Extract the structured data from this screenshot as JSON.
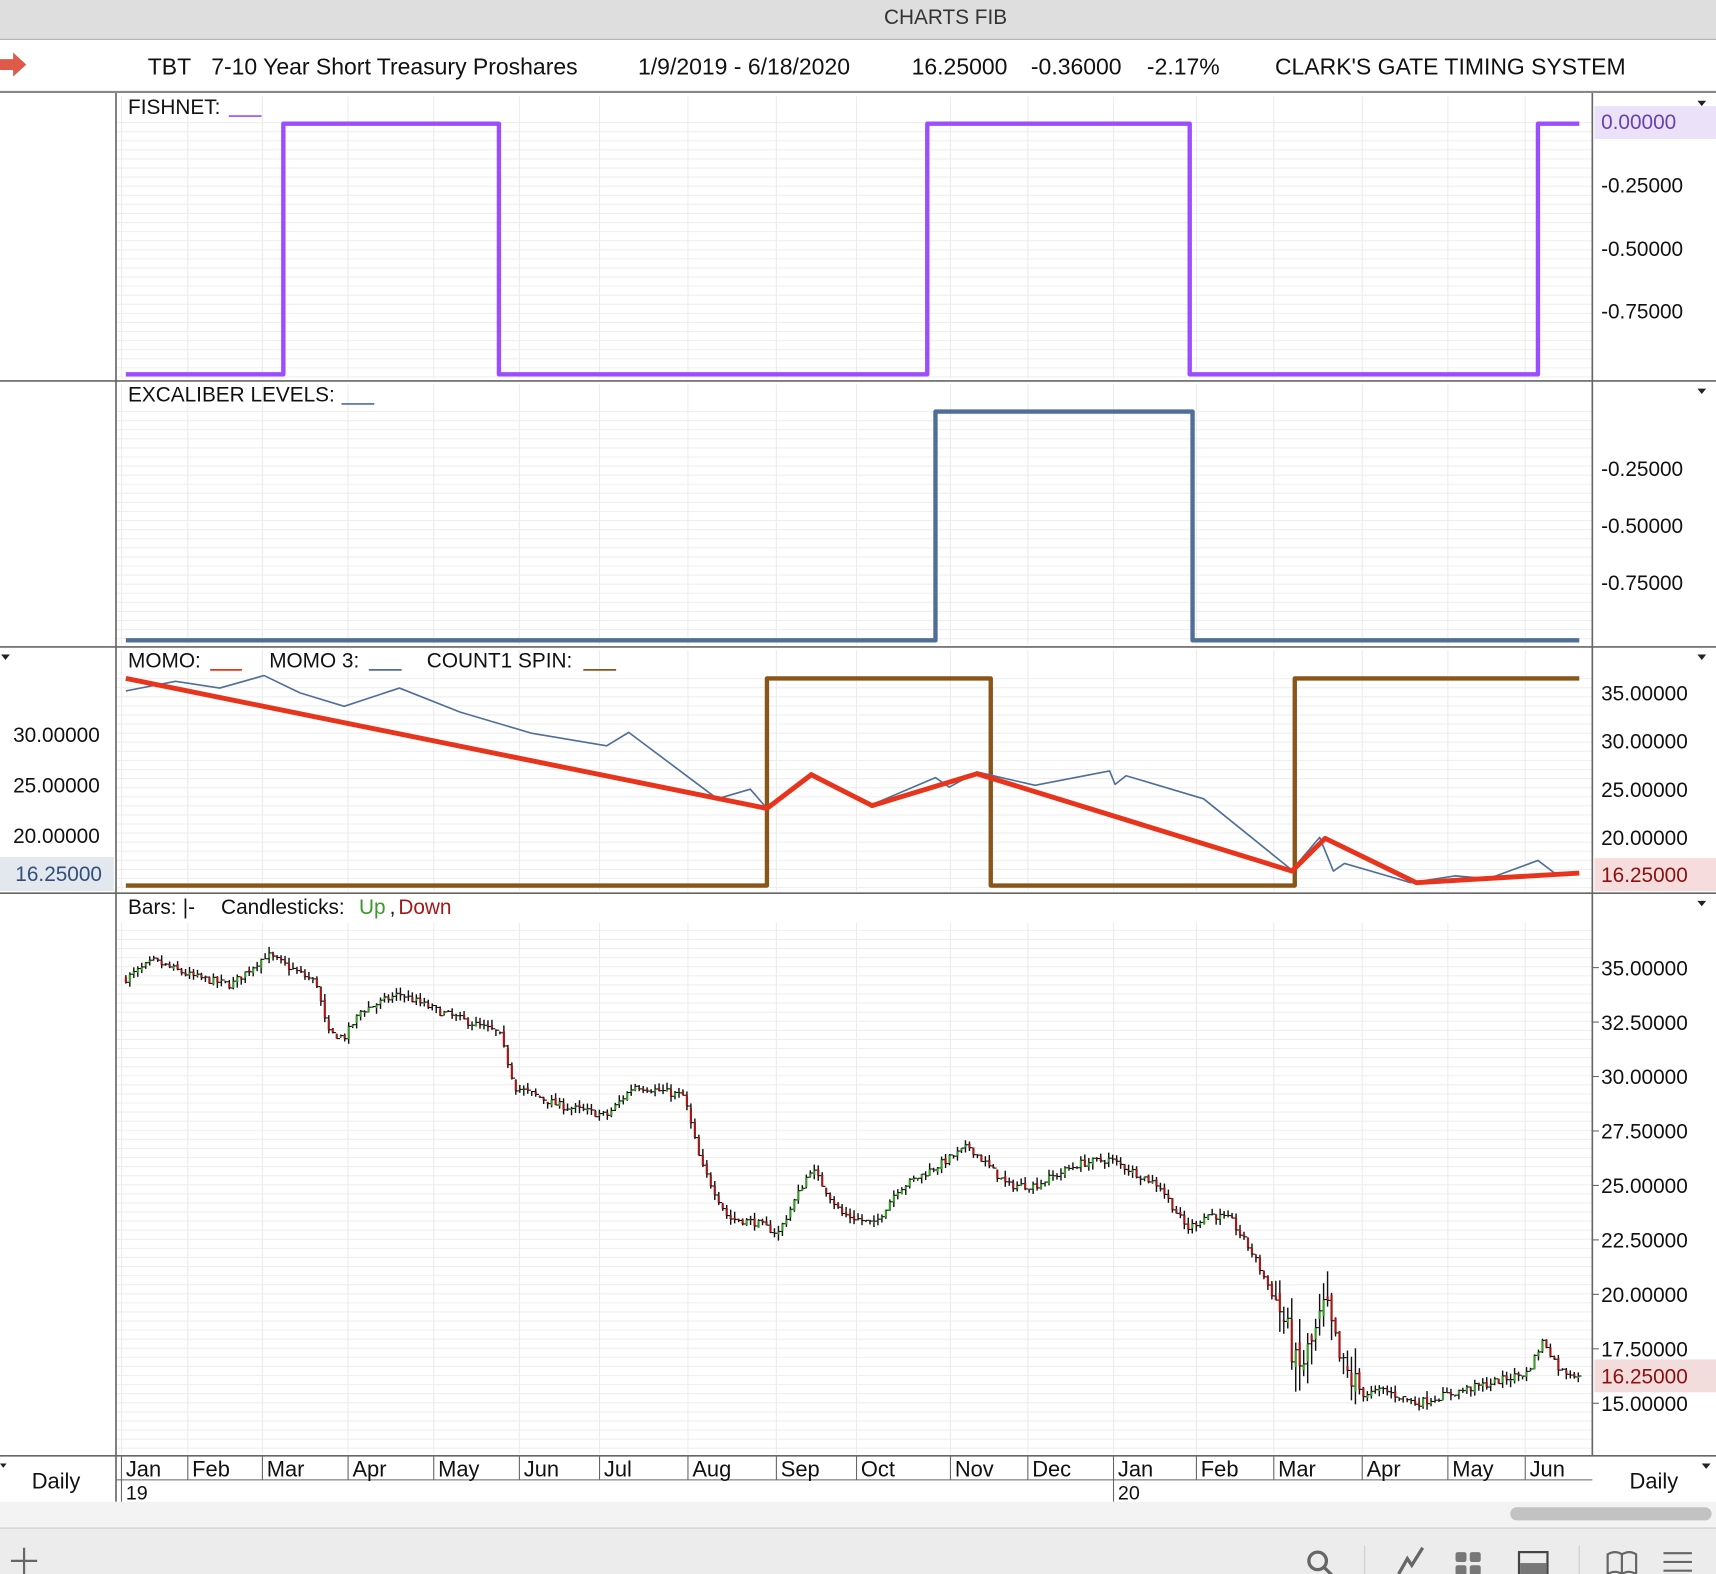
{
  "window": {
    "title": "CHARTS FIB"
  },
  "header": {
    "symbol": "TBT",
    "name": "7-10 Year Short Treasury Proshares",
    "date_range": "1/9/2019 - 6/18/2020",
    "last": "16.25000",
    "change": "-0.36000",
    "change_pct": "-2.17%",
    "system": "CLARK'S GATE TIMING SYSTEM"
  },
  "footer": {
    "period_left": "Daily",
    "period_right": "Daily"
  },
  "colors": {
    "fishnet": "#9b4dff",
    "excaliber": "#4f6f98",
    "momo": "#e8341c",
    "momo3": "#4f6f98",
    "count1": "#8a5518",
    "up": "#3a9a2a",
    "down": "#a51818"
  },
  "chart_data": [
    {
      "type": "line",
      "title": "FISHNET:",
      "x_unit": "calendar days since 1/9/2019",
      "ylim": [
        -1,
        0
      ],
      "yticks": [
        "0.00000",
        "-0.25000",
        "-0.50000",
        "-0.75000"
      ],
      "series": [
        {
          "name": "FISHNET",
          "step": true,
          "points": [
            [
              0,
              -1
            ],
            [
              57,
              -1
            ],
            [
              57,
              0
            ],
            [
              135,
              0
            ],
            [
              135,
              -1
            ],
            [
              290,
              -1
            ],
            [
              290,
              0
            ],
            [
              385,
              0
            ],
            [
              385,
              -1
            ],
            [
              511,
              -1
            ],
            [
              511,
              0
            ],
            [
              526,
              0
            ]
          ]
        }
      ]
    },
    {
      "type": "line",
      "title": "EXCALIBER LEVELS:",
      "x_unit": "calendar days since 1/9/2019",
      "ylim": [
        -1,
        0
      ],
      "yticks": [
        "-0.25000",
        "-0.50000",
        "-0.75000"
      ],
      "series": [
        {
          "name": "EXCALIBER LEVELS",
          "step": true,
          "points": [
            [
              0,
              -1
            ],
            [
              293,
              -1
            ],
            [
              293,
              0
            ],
            [
              386,
              0
            ],
            [
              386,
              -1
            ],
            [
              526,
              -1
            ]
          ]
        }
      ]
    },
    {
      "type": "line",
      "legend": [
        "MOMO:",
        "MOMO 3:",
        "COUNT1 SPIN:"
      ],
      "x_unit": "calendar days since 1/9/2019",
      "ylim": [
        14,
        37
      ],
      "yticks_right": [
        "35.00000",
        "30.00000",
        "25.00000",
        "20.00000"
      ],
      "yticks_left": [
        "30.00000",
        "25.00000",
        "20.00000"
      ],
      "last_value": "16.25000",
      "series": [
        {
          "name": "MOMO",
          "points": [
            [
              0,
              36.5
            ],
            [
              232,
              23.0
            ],
            [
              248,
              26.5
            ],
            [
              270,
              23.3
            ],
            [
              308,
              26.6
            ],
            [
              422,
              16.5
            ],
            [
              434,
              19.9
            ],
            [
              467,
              15.3
            ],
            [
              526,
              16.3
            ]
          ]
        },
        {
          "name": "MOMO 3",
          "points": [
            [
              0,
              35.2
            ],
            [
              18,
              36.2
            ],
            [
              34,
              35.5
            ],
            [
              50,
              36.8
            ],
            [
              63,
              35
            ],
            [
              79,
              33.6
            ],
            [
              99,
              35.5
            ],
            [
              121,
              33.0
            ],
            [
              147,
              30.8
            ],
            [
              174,
              29.5
            ],
            [
              182,
              30.9
            ],
            [
              214,
              24.0
            ],
            [
              226,
              25
            ],
            [
              232,
              23.0
            ],
            [
              248,
              26.7
            ],
            [
              270,
              23.4
            ],
            [
              293,
              26.2
            ],
            [
              298,
              25.2
            ],
            [
              308,
              26.8
            ],
            [
              329,
              25.4
            ],
            [
              356,
              26.9
            ],
            [
              358,
              25.5
            ],
            [
              362,
              26.4
            ],
            [
              390,
              24.0
            ],
            [
              422,
              16.6
            ],
            [
              432,
              20
            ],
            [
              437,
              16.5
            ],
            [
              441,
              17.3
            ],
            [
              465,
              15.3
            ],
            [
              481,
              16.0
            ],
            [
              493,
              15.7
            ],
            [
              511,
              17.6
            ],
            [
              517,
              16.3
            ]
          ]
        },
        {
          "name": "COUNT1 SPIN",
          "step": true,
          "points": [
            [
              0,
              15
            ],
            [
              232,
              15
            ],
            [
              232,
              36.5
            ],
            [
              313,
              36.5
            ],
            [
              313,
              15
            ],
            [
              423,
              15
            ],
            [
              423,
              36.5
            ],
            [
              526,
              36.5
            ]
          ]
        }
      ]
    },
    {
      "type": "candlestick",
      "legend": {
        "bars": "Bars:",
        "bars_symbol": "|-",
        "candles": "Candlesticks:",
        "up": "Up",
        "sep": ",",
        "down": "Down"
      },
      "x_unit": "calendar days since 1/9/2019",
      "ylim": [
        13.7,
        37
      ],
      "yticks": [
        "35.00000",
        "32.50000",
        "30.00000",
        "27.50000",
        "25.00000",
        "22.50000",
        "20.00000",
        "17.50000",
        "15.00000"
      ],
      "last_value": "16.25000",
      "close_path": [
        [
          0,
          34.5
        ],
        [
          10,
          35.3
        ],
        [
          24,
          34.6
        ],
        [
          38,
          34.2
        ],
        [
          51,
          35.6
        ],
        [
          69,
          34.3
        ],
        [
          73,
          32.0
        ],
        [
          79,
          31.8
        ],
        [
          85,
          33.0
        ],
        [
          99,
          33.8
        ],
        [
          113,
          33.0
        ],
        [
          135,
          32.0
        ],
        [
          141,
          29.5
        ],
        [
          147,
          29.2
        ],
        [
          156,
          28.7
        ],
        [
          174,
          28.2
        ],
        [
          184,
          29.6
        ],
        [
          202,
          29.1
        ],
        [
          208,
          26.0
        ],
        [
          218,
          23.5
        ],
        [
          228,
          23.3
        ],
        [
          236,
          22.8
        ],
        [
          248,
          25.8
        ],
        [
          259,
          23.7
        ],
        [
          271,
          23.2
        ],
        [
          279,
          24.8
        ],
        [
          295,
          26.0
        ],
        [
          305,
          26.8
        ],
        [
          319,
          25.0
        ],
        [
          329,
          25.0
        ],
        [
          345,
          26.0
        ],
        [
          356,
          26.2
        ],
        [
          374,
          25.0
        ],
        [
          384,
          23.0
        ],
        [
          392,
          23.7
        ],
        [
          400,
          23.4
        ],
        [
          408,
          21.8
        ],
        [
          418,
          19.2
        ],
        [
          422,
          17.5
        ],
        [
          424,
          16.3
        ],
        [
          430,
          18.0
        ],
        [
          434,
          19.5
        ],
        [
          440,
          16.6
        ],
        [
          448,
          15.4
        ],
        [
          455,
          15.6
        ],
        [
          467,
          15.0
        ],
        [
          481,
          15.5
        ],
        [
          493,
          15.9
        ],
        [
          507,
          16.4
        ],
        [
          513,
          17.9
        ],
        [
          519,
          16.5
        ],
        [
          526,
          16.3
        ]
      ]
    }
  ],
  "time_axis": {
    "months": [
      {
        "label": "Jan",
        "day": 0
      },
      {
        "label": "Feb",
        "day": 24
      },
      {
        "label": "Mar",
        "day": 51
      },
      {
        "label": "Apr",
        "day": 82
      },
      {
        "label": "May",
        "day": 113
      },
      {
        "label": "Jun",
        "day": 144
      },
      {
        "label": "Jul",
        "day": 173
      },
      {
        "label": "Aug",
        "day": 205
      },
      {
        "label": "Sep",
        "day": 237
      },
      {
        "label": "Oct",
        "day": 266
      },
      {
        "label": "Nov",
        "day": 300
      },
      {
        "label": "Dec",
        "day": 328
      },
      {
        "label": "Jan",
        "day": 359
      },
      {
        "label": "Feb",
        "day": 389
      },
      {
        "label": "Mar",
        "day": 417
      },
      {
        "label": "Apr",
        "day": 449
      },
      {
        "label": "May",
        "day": 480
      },
      {
        "label": "Jun",
        "day": 508
      }
    ],
    "years": [
      {
        "label": "19",
        "day": 0
      },
      {
        "label": "20",
        "day": 359
      }
    ]
  }
}
